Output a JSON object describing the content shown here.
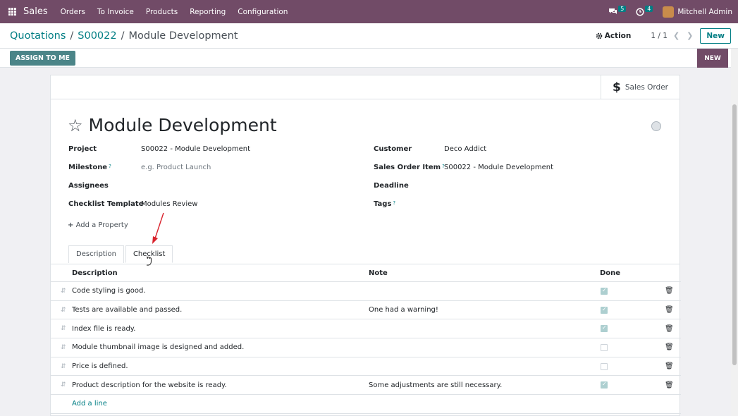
{
  "topbar": {
    "app_name": "Sales",
    "menu": [
      "Orders",
      "To Invoice",
      "Products",
      "Reporting",
      "Configuration"
    ],
    "messages_count": "5",
    "activities_count": "4",
    "user_name": "Mitchell Admin"
  },
  "breadcrumb": {
    "parent": "Quotations",
    "sep": "/",
    "order": "S00022",
    "current": "Module Development"
  },
  "control": {
    "action_label": "Action",
    "pager": "1 / 1",
    "new_label": "New"
  },
  "status": {
    "assign_label": "ASSIGN TO ME",
    "stage_label": "NEW"
  },
  "smart_button": {
    "label": "Sales Order",
    "icon": "dollar-icon"
  },
  "form": {
    "title": "Module Development",
    "left_fields": [
      {
        "label": "Project",
        "tip": "",
        "value": "S00022 - Module Development",
        "placeholder": false
      },
      {
        "label": "Milestone",
        "tip": "?",
        "value": "e.g. Product Launch",
        "placeholder": true
      },
      {
        "label": "Assignees",
        "tip": "",
        "value": "",
        "placeholder": false
      },
      {
        "label": "Checklist Template",
        "tip": "",
        "value": "Modules Review",
        "placeholder": false
      }
    ],
    "right_fields": [
      {
        "label": "Customer",
        "tip": "",
        "value": "Deco Addict"
      },
      {
        "label": "Sales Order Item",
        "tip": "?",
        "value": "S00022 - Module Development"
      },
      {
        "label": "Deadline",
        "tip": "",
        "value": ""
      },
      {
        "label": "Tags",
        "tip": "?",
        "value": ""
      }
    ],
    "add_property": "Add a Property"
  },
  "tabs": {
    "description": "Description",
    "checklist": "Checklist"
  },
  "checklist": {
    "headers": {
      "description": "Description",
      "note": "Note",
      "done": "Done"
    },
    "rows": [
      {
        "description": "Code styling is good.",
        "note": "",
        "done": true
      },
      {
        "description": "Tests are available and passed.",
        "note": "One had a warning!",
        "done": true
      },
      {
        "description": "Index file is ready.",
        "note": "",
        "done": true
      },
      {
        "description": "Module thumbnail image is designed and added.",
        "note": "",
        "done": false
      },
      {
        "description": "Price is defined.",
        "note": "",
        "done": false
      },
      {
        "description": "Product description for the website is ready.",
        "note": "Some adjustments are still necessary.",
        "done": true
      }
    ],
    "add_line": "Add a line"
  },
  "colors": {
    "brand": "#714b67",
    "accent": "#017e84",
    "annotation_arrow": "#d9232d"
  }
}
